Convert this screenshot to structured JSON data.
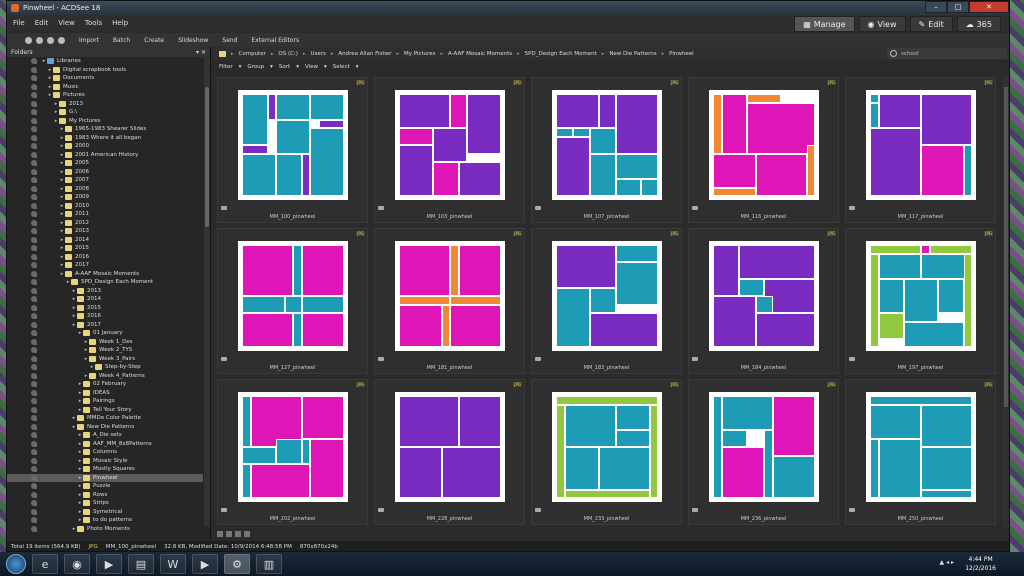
{
  "window": {
    "title": "Pinwheel - ACDSee 18"
  },
  "menu": [
    "File",
    "Edit",
    "View",
    "Tools",
    "Help"
  ],
  "modes": [
    {
      "label": "Manage",
      "icon": "grid-icon",
      "active": true
    },
    {
      "label": "View",
      "icon": "eye-icon",
      "active": false
    },
    {
      "label": "Edit",
      "icon": "edit-icon",
      "active": false
    },
    {
      "label": "365",
      "icon": "cloud-icon",
      "active": false
    }
  ],
  "toolbar": [
    "Import",
    "Batch",
    "Create",
    "Slideshow",
    "Send",
    "External Editors"
  ],
  "folders": {
    "title": "Folders",
    "items": [
      {
        "label": "Libraries",
        "indent": 0,
        "blue": true
      },
      {
        "label": "Digital scrapbook tools",
        "indent": 1
      },
      {
        "label": "Documents",
        "indent": 1
      },
      {
        "label": "Music",
        "indent": 1
      },
      {
        "label": "Pictures",
        "indent": 1
      },
      {
        "label": "2013",
        "indent": 2
      },
      {
        "label": "G:\\",
        "indent": 2
      },
      {
        "label": "My Pictures",
        "indent": 2
      },
      {
        "label": "1965-1983  Shearer Slides",
        "indent": 3
      },
      {
        "label": "1983 Where it all began",
        "indent": 3
      },
      {
        "label": "2000",
        "indent": 3
      },
      {
        "label": "2001 American History",
        "indent": 3
      },
      {
        "label": "2005",
        "indent": 3
      },
      {
        "label": "2006",
        "indent": 3
      },
      {
        "label": "2007",
        "indent": 3
      },
      {
        "label": "2008",
        "indent": 3
      },
      {
        "label": "2009",
        "indent": 3
      },
      {
        "label": "2010",
        "indent": 3
      },
      {
        "label": "2011",
        "indent": 3
      },
      {
        "label": "2012",
        "indent": 3
      },
      {
        "label": "2013",
        "indent": 3
      },
      {
        "label": "2014",
        "indent": 3
      },
      {
        "label": "2015",
        "indent": 3
      },
      {
        "label": "2016",
        "indent": 3
      },
      {
        "label": "2017",
        "indent": 3
      },
      {
        "label": "A-AAF Mosaic Moments",
        "indent": 3
      },
      {
        "label": "5PD_Design Each Moment",
        "indent": 4
      },
      {
        "label": "2013",
        "indent": 5
      },
      {
        "label": "2014",
        "indent": 5
      },
      {
        "label": "2015",
        "indent": 5
      },
      {
        "label": "2016",
        "indent": 5
      },
      {
        "label": "2017",
        "indent": 5
      },
      {
        "label": "01 January",
        "indent": 6
      },
      {
        "label": "Week 1_Des",
        "indent": 7
      },
      {
        "label": "Week 2_TYS",
        "indent": 7
      },
      {
        "label": "Week 3_Pairs",
        "indent": 7
      },
      {
        "label": "Step-by-Step",
        "indent": 8
      },
      {
        "label": "Week 4_Patterns",
        "indent": 7
      },
      {
        "label": "02 February",
        "indent": 6
      },
      {
        "label": "IDEAS",
        "indent": 6
      },
      {
        "label": "Pairings",
        "indent": 6
      },
      {
        "label": "Tell Your Story",
        "indent": 6
      },
      {
        "label": "MMDe Color Palette",
        "indent": 5
      },
      {
        "label": "New Die Patterns",
        "indent": 5
      },
      {
        "label": "A_Die sets",
        "indent": 6
      },
      {
        "label": "AAF_MM_8x8Patterns",
        "indent": 6
      },
      {
        "label": "Columns",
        "indent": 6
      },
      {
        "label": "Mosaic Style",
        "indent": 6
      },
      {
        "label": "Mostly Squares",
        "indent": 6
      },
      {
        "label": "Pinwheel",
        "indent": 6,
        "selected": true
      },
      {
        "label": "Puzzle",
        "indent": 6
      },
      {
        "label": "Rows",
        "indent": 6
      },
      {
        "label": "Strips",
        "indent": 6
      },
      {
        "label": "Symetrical",
        "indent": 6
      },
      {
        "label": "to do patterns",
        "indent": 6
      },
      {
        "label": "Photo Moments",
        "indent": 5
      }
    ]
  },
  "breadcrumb": [
    "Computer",
    "OS (C:)",
    "Users",
    "Andrea Allan Fisher",
    "My Pictures",
    "A-AAF Mosaic Moments",
    "5PD_Design Each Moment",
    "New Die Patterns",
    "Pinwheel"
  ],
  "search": {
    "value": "school"
  },
  "filters": [
    "Filter",
    "Group",
    "Sort",
    "View",
    "Select"
  ],
  "colors": {
    "teal": "#1e9bb5",
    "purple": "#7a2cc0",
    "magenta": "#e015b8",
    "orange": "#ee8a35",
    "green": "#92c83e"
  },
  "thumbs": [
    {
      "name": "MM_100_pinwheel",
      "badge": "JPG"
    },
    {
      "name": "MM_103_pinwheel",
      "badge": "JPG"
    },
    {
      "name": "MM_107_pinwheel",
      "badge": "JPG"
    },
    {
      "name": "MM_116_pinwheel",
      "badge": "JPG"
    },
    {
      "name": "MM_117_pinwheel",
      "badge": "JPG"
    },
    {
      "name": "MM_127_pinwheel",
      "badge": "JPG"
    },
    {
      "name": "MM_181_pinwheel",
      "badge": "JPG"
    },
    {
      "name": "MM_183_pinwheel",
      "badge": "JPG"
    },
    {
      "name": "MM_184_pinwheel",
      "badge": "JPG"
    },
    {
      "name": "MM_197_pinwheel",
      "badge": "JPG"
    },
    {
      "name": "MM_202_pinwheel",
      "badge": "JPG"
    },
    {
      "name": "MM_228_pinwheel",
      "badge": "JPG"
    },
    {
      "name": "MM_233_pinwheel",
      "badge": "JPG"
    },
    {
      "name": "MM_236_pinwheel",
      "badge": "JPG"
    },
    {
      "name": "MM_250_pinwheel",
      "badge": "JPG"
    }
  ],
  "status": {
    "total": "Total 19 items  (564.9 KB)",
    "type": "JPG",
    "file": "MM_100_pinwheel",
    "info": "32.8 KB, Modified Date: 10/9/2014 6:48:58 PM",
    "dims": "870x870x24b"
  },
  "clock": {
    "time": "4:44 PM",
    "date": "12/2/2016"
  }
}
